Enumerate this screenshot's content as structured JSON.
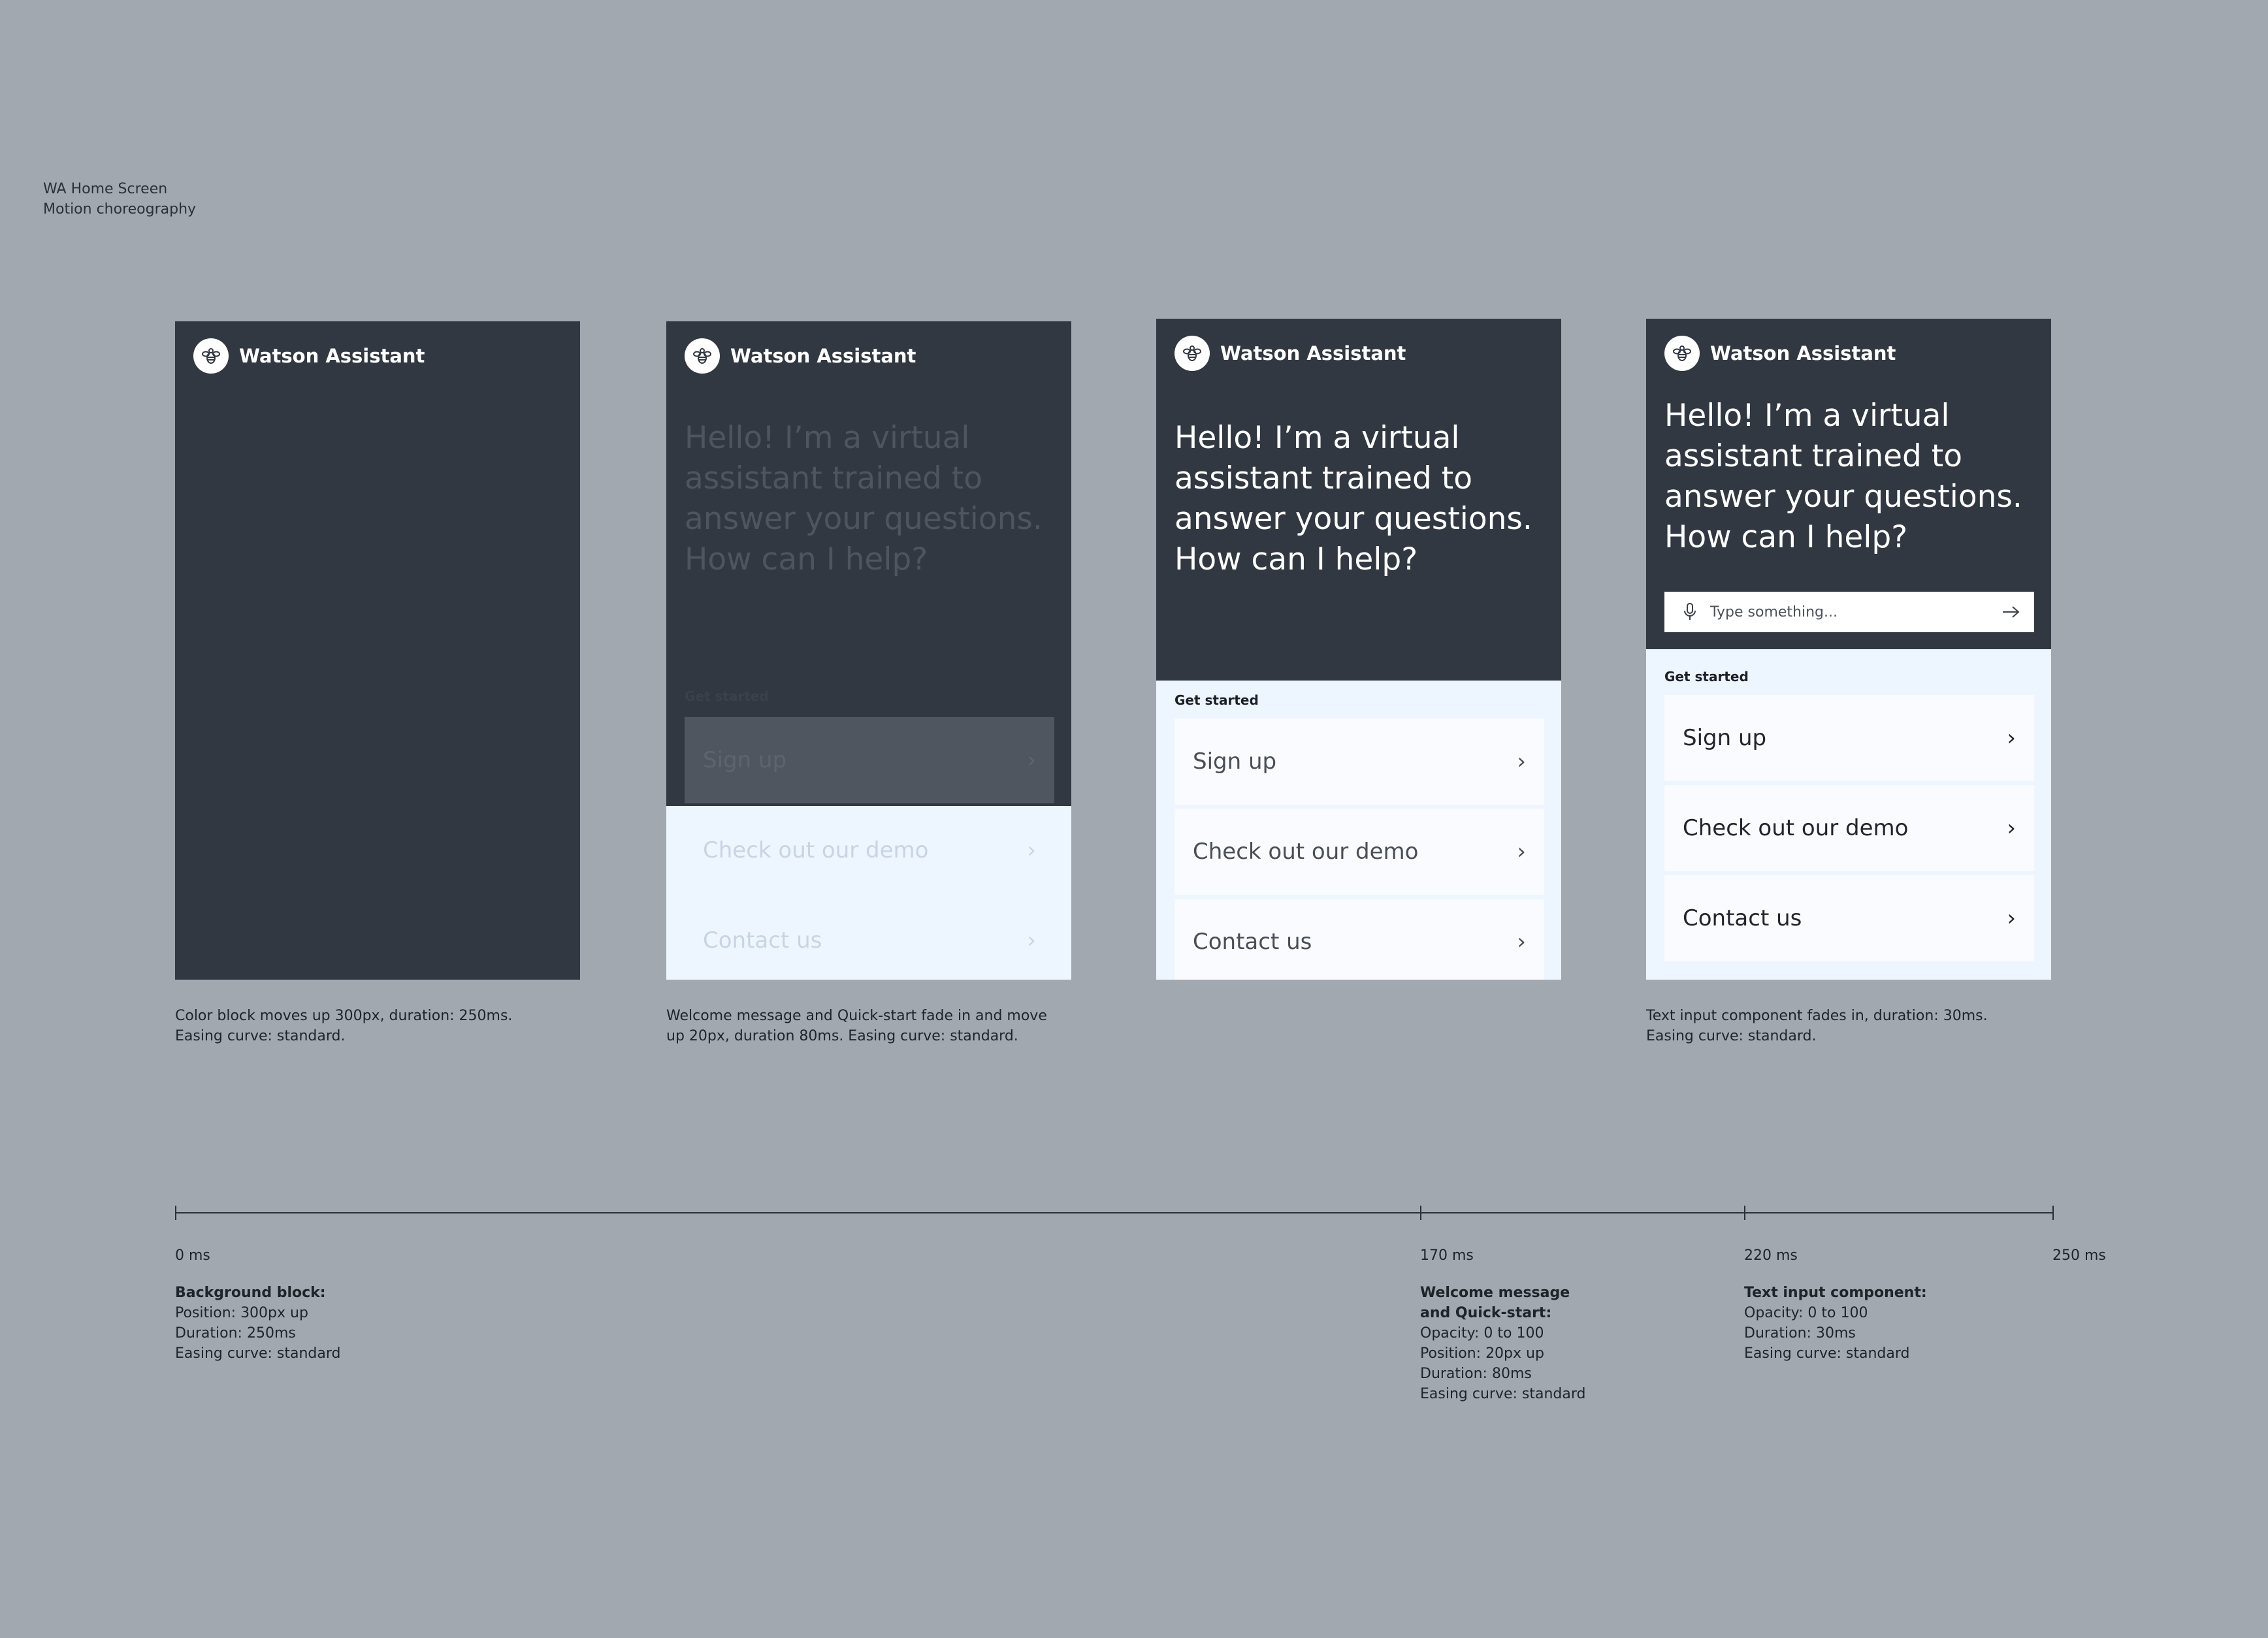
{
  "page": {
    "title_line1": "WA Home Screen",
    "title_line2": "Motion choreography"
  },
  "phone": {
    "brand": "Watson Assistant",
    "avatar_icon": "bee-icon",
    "welcome_lines": [
      "Hello! I’m a virtual",
      "assistant trained to",
      "answer your questions.",
      "How can I help?"
    ],
    "quick_start_label": "Get started",
    "quick_start_items": [
      "Sign up",
      "Check out our demo",
      "Contact us"
    ],
    "input_placeholder": "Type something...",
    "mic_icon": "microphone-icon",
    "send_icon": "arrow-right-icon",
    "chevron_icon": "chevron-right-icon"
  },
  "captions": {
    "frame1_line1": "Color block moves up 300px, duration: 250ms.",
    "frame1_line2": "Easing curve: standard.",
    "frame2_line1": "Welcome message and Quick-start fade in and move",
    "frame2_line2": "up 20px, duration 80ms. Easing curve: standard.",
    "frame4_line1": "Text input component fades in, duration: 30ms.",
    "frame4_line2": "Easing curve: standard."
  },
  "timeline": {
    "ticks": [
      "0 ms",
      "170 ms",
      "220 ms",
      "250 ms"
    ],
    "notes": [
      {
        "title": "Background block:",
        "lines": [
          "Position: 300px up",
          "Duration: 250ms",
          "Easing curve: standard"
        ]
      },
      {
        "title_line1": "Welcome message",
        "title_line2": "and Quick-start:",
        "lines": [
          "Opacity: 0 to 100",
          "Position: 20px up",
          "Duration: 80ms",
          "Easing curve: standard"
        ]
      },
      {
        "title": "Text input component:",
        "lines": [
          "Opacity: 0 to 100",
          "Duration: 30ms",
          "Easing curve: standard"
        ]
      }
    ]
  },
  "colors": {
    "background": "#a1a8b0",
    "phone_dark": "#323841",
    "quick_start_bg": "#edf5ff",
    "card": "#f9fbff"
  }
}
